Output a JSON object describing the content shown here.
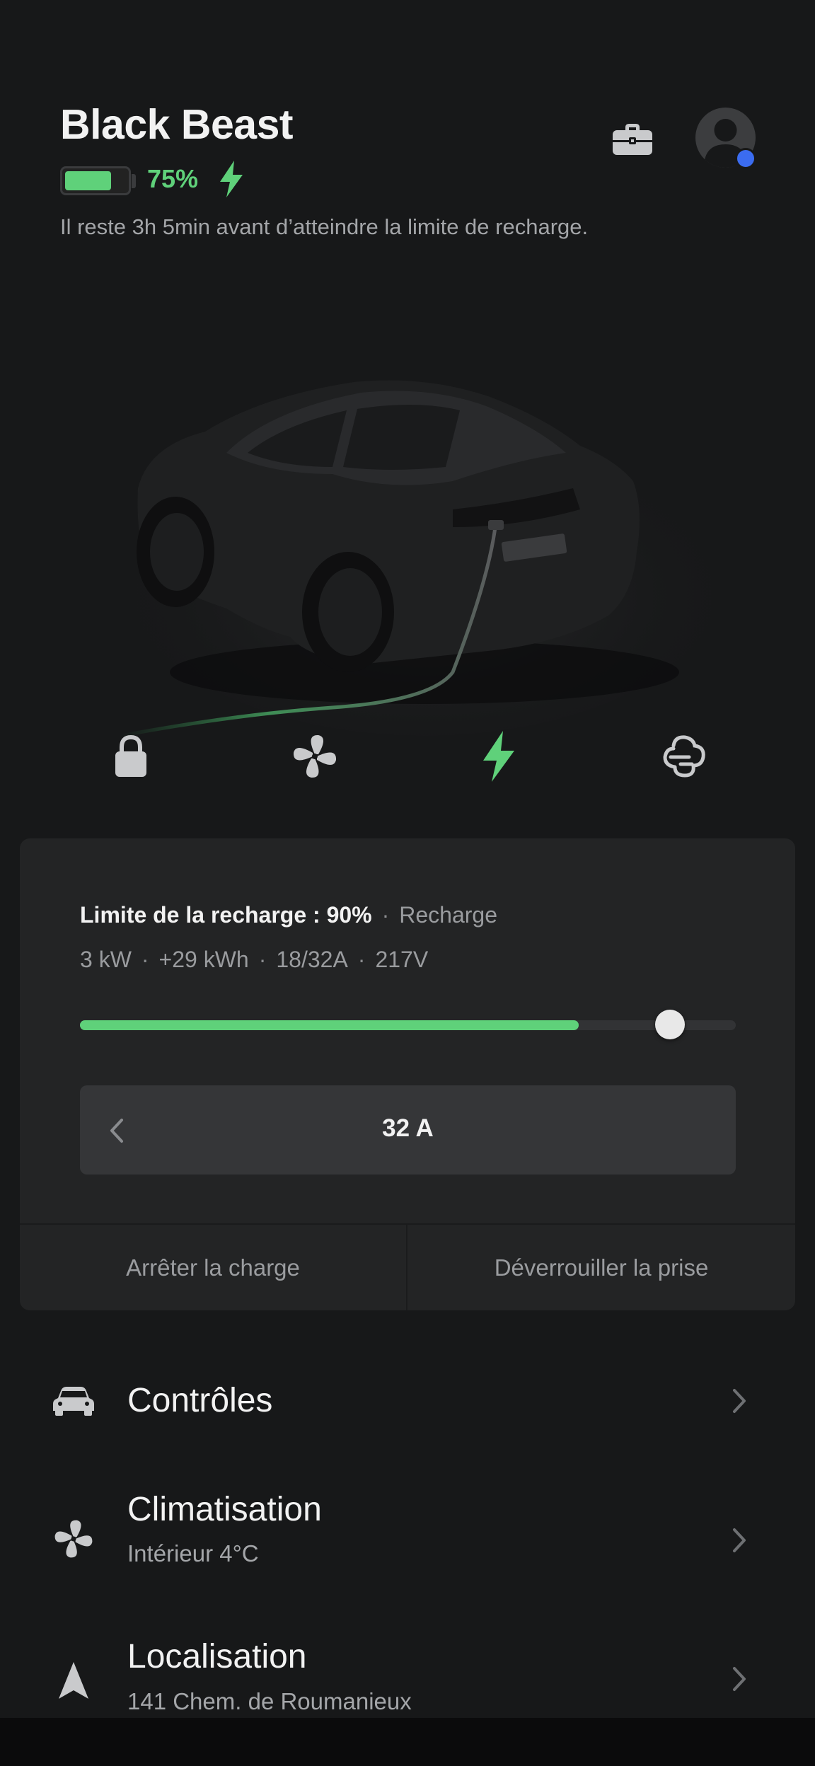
{
  "header": {
    "vehicle_name": "Black Beast",
    "battery_percent_label": "75%",
    "battery_level": 0.75,
    "charge_info": "Il reste 3h 5min avant d’atteindre la limite de recharge."
  },
  "quick_actions": [
    "lock-icon",
    "fan-icon",
    "charge-bolt-icon",
    "defrost-icon"
  ],
  "charging_card": {
    "limit_label": "Limite de la recharge : 90%",
    "status_label": "Recharge",
    "stats": [
      "3 kW",
      "+29 kWh",
      "18/32A",
      "217V"
    ],
    "current_charge_fraction": 0.76,
    "limit_fraction": 0.9,
    "amperage": "32 A",
    "stop_button": "Arrêter la charge",
    "unlock_button": "Déverrouiller la prise"
  },
  "menu": {
    "controls": {
      "title": "Contrôles"
    },
    "climate": {
      "title": "Climatisation",
      "subtitle": "Intérieur 4°C"
    },
    "location": {
      "title": "Localisation",
      "subtitle": "141 Chem. de Roumanieux"
    }
  },
  "colors": {
    "accent_green": "#5fd17a",
    "background": "#171819",
    "card": "#232425",
    "notification_blue": "#3b6cf0"
  }
}
